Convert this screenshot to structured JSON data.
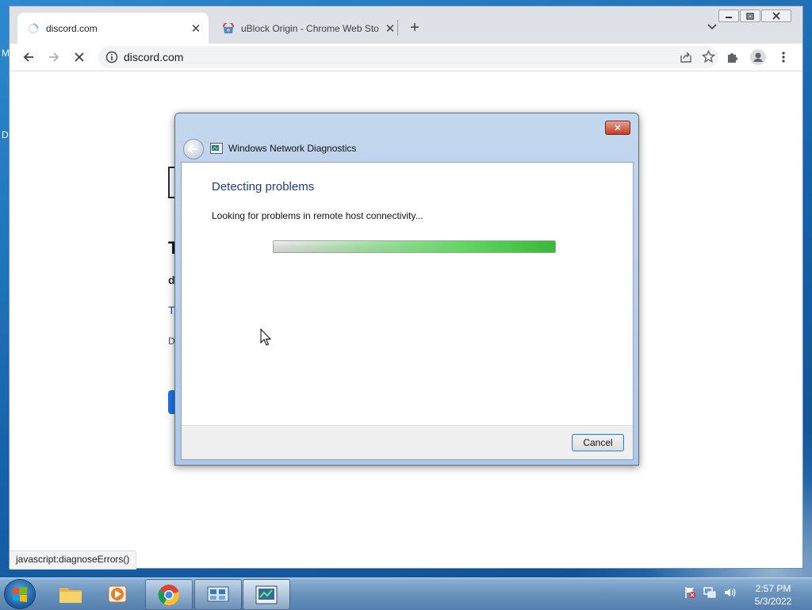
{
  "desktop": {
    "edge_text_top": "M",
    "edge_text_mid": "D"
  },
  "browser": {
    "tabs": [
      {
        "title": "discord.com",
        "state": "loading"
      },
      {
        "title": "uBlock Origin - Chrome Web Sto",
        "state": "inactive"
      }
    ],
    "address": "discord.com",
    "status_url": "javascript:diagnoseErrors()"
  },
  "page_fragments": {
    "heading_initial": "T",
    "subheading_initial": "d",
    "link_initial": "T",
    "text_initial": "D"
  },
  "dialog": {
    "title": "Windows Network Diagnostics",
    "heading": "Detecting problems",
    "status": "Looking for problems in remote host connectivity...",
    "progress_percent": 100,
    "cancel_label": "Cancel",
    "close_symbol": "✕"
  },
  "taskbar": {
    "apps": [
      "start-orb",
      "file-explorer",
      "media-player",
      "google-chrome",
      "network-connections",
      "network-diagnostics"
    ],
    "clock_time": "2:57 PM",
    "clock_date": "5/3/2022"
  },
  "colors": {
    "dialog_heading": "#1e3e82",
    "progress_green": "#38b838",
    "chrome_tab_strip": "#dee1e6"
  }
}
